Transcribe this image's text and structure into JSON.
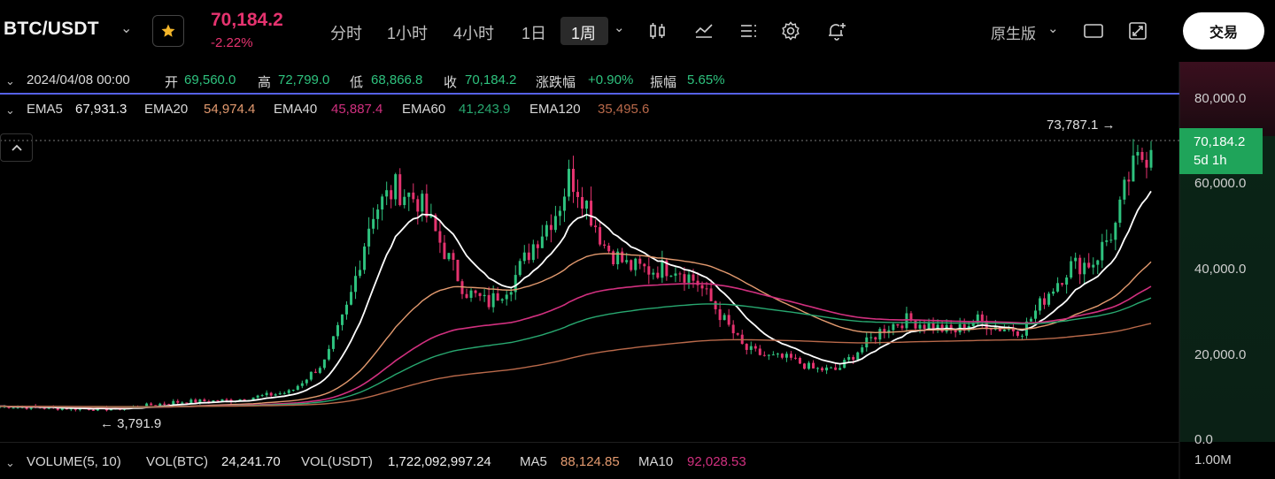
{
  "colors": {
    "up": "#2ec27e",
    "down": "#e5336f",
    "ema5": "#ffffff",
    "ema20": "#e39a6f",
    "ema40": "#d1307f",
    "ema60": "#28a870",
    "ema120": "#b9694a",
    "blue_line": "#5561e6",
    "price_tag": "#1fa45a",
    "star": "#f4b62a"
  },
  "header": {
    "pair": "BTC/USDT",
    "favorite_icon": "star-icon",
    "last_price": "70,184.2",
    "change_pct": "-2.22%",
    "timeframes": [
      "分时",
      "1小时",
      "4小时",
      "1日"
    ],
    "active_timeframe": "1周",
    "tool_icons": [
      "candle-type-icon",
      "indicator-icon",
      "drawing-list-icon",
      "settings-icon",
      "alert-add-icon"
    ],
    "version_label": "原生版",
    "trade_button": "交易"
  },
  "ohlc": {
    "date": "2024/04/08 00:00",
    "open_label": "开",
    "open": "69,560.0",
    "high_label": "高",
    "high": "72,799.0",
    "low_label": "低",
    "low": "68,866.8",
    "close_label": "收",
    "close": "70,184.2",
    "change_label": "涨跌幅",
    "change": "+0.90%",
    "amplitude_label": "振幅",
    "amplitude": "5.65%"
  },
  "ema": {
    "ema5_label": "EMA5",
    "ema5": "67,931.3",
    "ema20_label": "EMA20",
    "ema20": "54,974.4",
    "ema40_label": "EMA40",
    "ema40": "45,887.4",
    "ema60_label": "EMA60",
    "ema60": "41,243.9",
    "ema120_label": "EMA120",
    "ema120": "35,495.6"
  },
  "chart": {
    "y_axis_labels": [
      "80,000.0",
      "60,000.0",
      "40,000.0",
      "20,000.0",
      "0.0"
    ],
    "high_marker": "73,787.1",
    "low_marker": "3,791.9",
    "current_price_tag": "70,184.2",
    "countdown": "5d 1h"
  },
  "chart_data": {
    "type": "candlestick",
    "y_ticks": [
      0,
      20000,
      40000,
      60000,
      80000
    ],
    "approx_close_path": [
      [
        0,
        8000
      ],
      [
        5,
        7500
      ],
      [
        10,
        7300
      ],
      [
        15,
        9000
      ],
      [
        20,
        9500
      ],
      [
        25,
        11500
      ],
      [
        28,
        19000
      ],
      [
        30,
        33000
      ],
      [
        32,
        55000
      ],
      [
        34,
        61000
      ],
      [
        36,
        58000
      ],
      [
        38,
        47000
      ],
      [
        40,
        36000
      ],
      [
        42,
        33000
      ],
      [
        44,
        38000
      ],
      [
        46,
        48000
      ],
      [
        48,
        56000
      ],
      [
        49,
        64000
      ],
      [
        50,
        60000
      ],
      [
        52,
        47000
      ],
      [
        54,
        42000
      ],
      [
        56,
        41000
      ],
      [
        58,
        42000
      ],
      [
        60,
        38000
      ],
      [
        62,
        30000
      ],
      [
        64,
        22000
      ],
      [
        66,
        20000
      ],
      [
        68,
        19500
      ],
      [
        70,
        17000
      ],
      [
        72,
        16800
      ],
      [
        74,
        22000
      ],
      [
        76,
        27000
      ],
      [
        78,
        29000
      ],
      [
        80,
        27500
      ],
      [
        82,
        26000
      ],
      [
        84,
        29000
      ],
      [
        86,
        27000
      ],
      [
        88,
        26500
      ],
      [
        90,
        35000
      ],
      [
        92,
        42000
      ],
      [
        94,
        43000
      ],
      [
        96,
        52000
      ],
      [
        97,
        63000
      ],
      [
        98,
        68000
      ],
      [
        99,
        70184.2
      ]
    ],
    "x_range": [
      0,
      99
    ],
    "ylim": [
      0,
      84000
    ]
  },
  "volume": {
    "label": "VOLUME(5, 10)",
    "vol_btc_label": "VOL(BTC)",
    "vol_btc": "24,241.70",
    "vol_usdt_label": "VOL(USDT)",
    "vol_usdt": "1,722,092,997.24",
    "ma5_label": "MA5",
    "ma5": "88,124.85",
    "ma10_label": "MA10",
    "ma10": "92,028.53",
    "axis_label": "1.00M"
  }
}
